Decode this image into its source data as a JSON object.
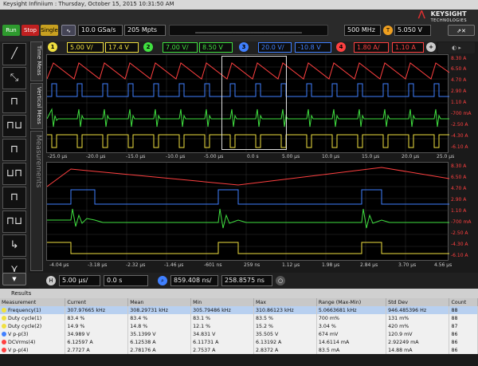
{
  "window": {
    "title": "Keysight Infiniium : Thursday, October 15, 2015 10:31:50 AM"
  },
  "brand": {
    "name": "KEYSIGHT",
    "sub": "TECHNOLOGIES"
  },
  "toolbar": {
    "run": "Run",
    "stop": "Stop",
    "single": "Single",
    "sample_rate": "10.0 GSa/s",
    "points": "205 Mpts",
    "bandwidth": "500 MHz",
    "trigger_level": "5.050 V",
    "trigger_tag": "T"
  },
  "channels": [
    {
      "num": "1",
      "scale": "5.00 V/",
      "offset": "17.4 V",
      "color": "#f0e040"
    },
    {
      "num": "2",
      "scale": "7.00 V/",
      "offset": "8.50 V",
      "color": "#40e040"
    },
    {
      "num": "3",
      "scale": "20.0 V/",
      "offset": "-10.8 V",
      "color": "#4080ff"
    },
    {
      "num": "4",
      "scale": "1.80 A/",
      "offset": "1.10 A",
      "color": "#ff4040"
    }
  ],
  "side_tabs": {
    "time_meas": "Time Meas",
    "vertical_meas": "Vertical Meas",
    "measurements": "Measurements"
  },
  "upper_plot": {
    "x_ticks": [
      "-25.0 µs",
      "-20.0 µs",
      "-15.0 µs",
      "-10.0 µs",
      "-5.00 µs",
      "0.0 s",
      "5.00 µs",
      "10.0 µs",
      "15.0 µs",
      "20.0 µs",
      "25.0 µs"
    ],
    "right_labels": [
      "8.30 A",
      "6.50 A",
      "4.70 A",
      "2.90 A",
      "1.10 A",
      "-700 mA",
      "-2.50 A",
      "-4.30 A",
      "-6.10 A"
    ]
  },
  "lower_plot": {
    "x_ticks": [
      "-4.04 µs",
      "-3.18 µs",
      "-2.32 µs",
      "-1.46 µs",
      "-601 ns",
      "259 ns",
      "1.12 µs",
      "1.98 µs",
      "2.84 µs",
      "3.70 µs",
      "4.56 µs"
    ],
    "right_labels": [
      "8.30 A",
      "6.50 A",
      "4.70 A",
      "2.90 A",
      "1.10 A",
      "-700 mA",
      "-2.50 A",
      "-4.30 A",
      "-6.10 A"
    ]
  },
  "timebase": {
    "h_tag": "H",
    "scale": "5.00 µs/",
    "delay": "0.0 s",
    "zoom_scale": "859.408 ns/",
    "zoom_delay": "258.8575 ns"
  },
  "results": {
    "title": "Results",
    "columns": [
      "Measurement",
      "Current",
      "Mean",
      "Min",
      "Max",
      "Range (Max-Min)",
      "Std Dev",
      "Count"
    ],
    "rows": [
      {
        "dot": "#f0e040",
        "cells": [
          "Frequency(1)",
          "307.97665 kHz",
          "308.29731 kHz",
          "305.79486 kHz",
          "310.86123 kHz",
          "5.0663681 kHz",
          "946.485396 Hz",
          "88"
        ]
      },
      {
        "dot": "#f0e040",
        "cells": [
          "Duty cycle(1)",
          "83.4 %",
          "83.4 %",
          "83.1 %",
          "83.5 %",
          "700 m%",
          "131 m%",
          "88"
        ]
      },
      {
        "dot": "#f0e040",
        "cells": [
          "Duty cycle(2)",
          "14.9 %",
          "14.8 %",
          "12.1 %",
          "15.2 %",
          "3.04 %",
          "420 m%",
          "87"
        ]
      },
      {
        "dot": "#4080ff",
        "cells": [
          "V p-p(3)",
          "34.989 V",
          "35.1399 V",
          "34.831 V",
          "35.505 V",
          "674 mV",
          "120.9 mV",
          "86"
        ]
      },
      {
        "dot": "#ff4040",
        "cells": [
          "DCVrms(4)",
          "6.12597 A",
          "6.12538 A",
          "6.11731 A",
          "6.13192 A",
          "14.6114 mA",
          "2.92249 mA",
          "86"
        ]
      },
      {
        "dot": "#ff4040",
        "cells": [
          "V p-p(4)",
          "2.7727 A",
          "2.78176 A",
          "2.7537 A",
          "2.8372 A",
          "83.5 mA",
          "14.88 mA",
          "86"
        ]
      }
    ]
  }
}
